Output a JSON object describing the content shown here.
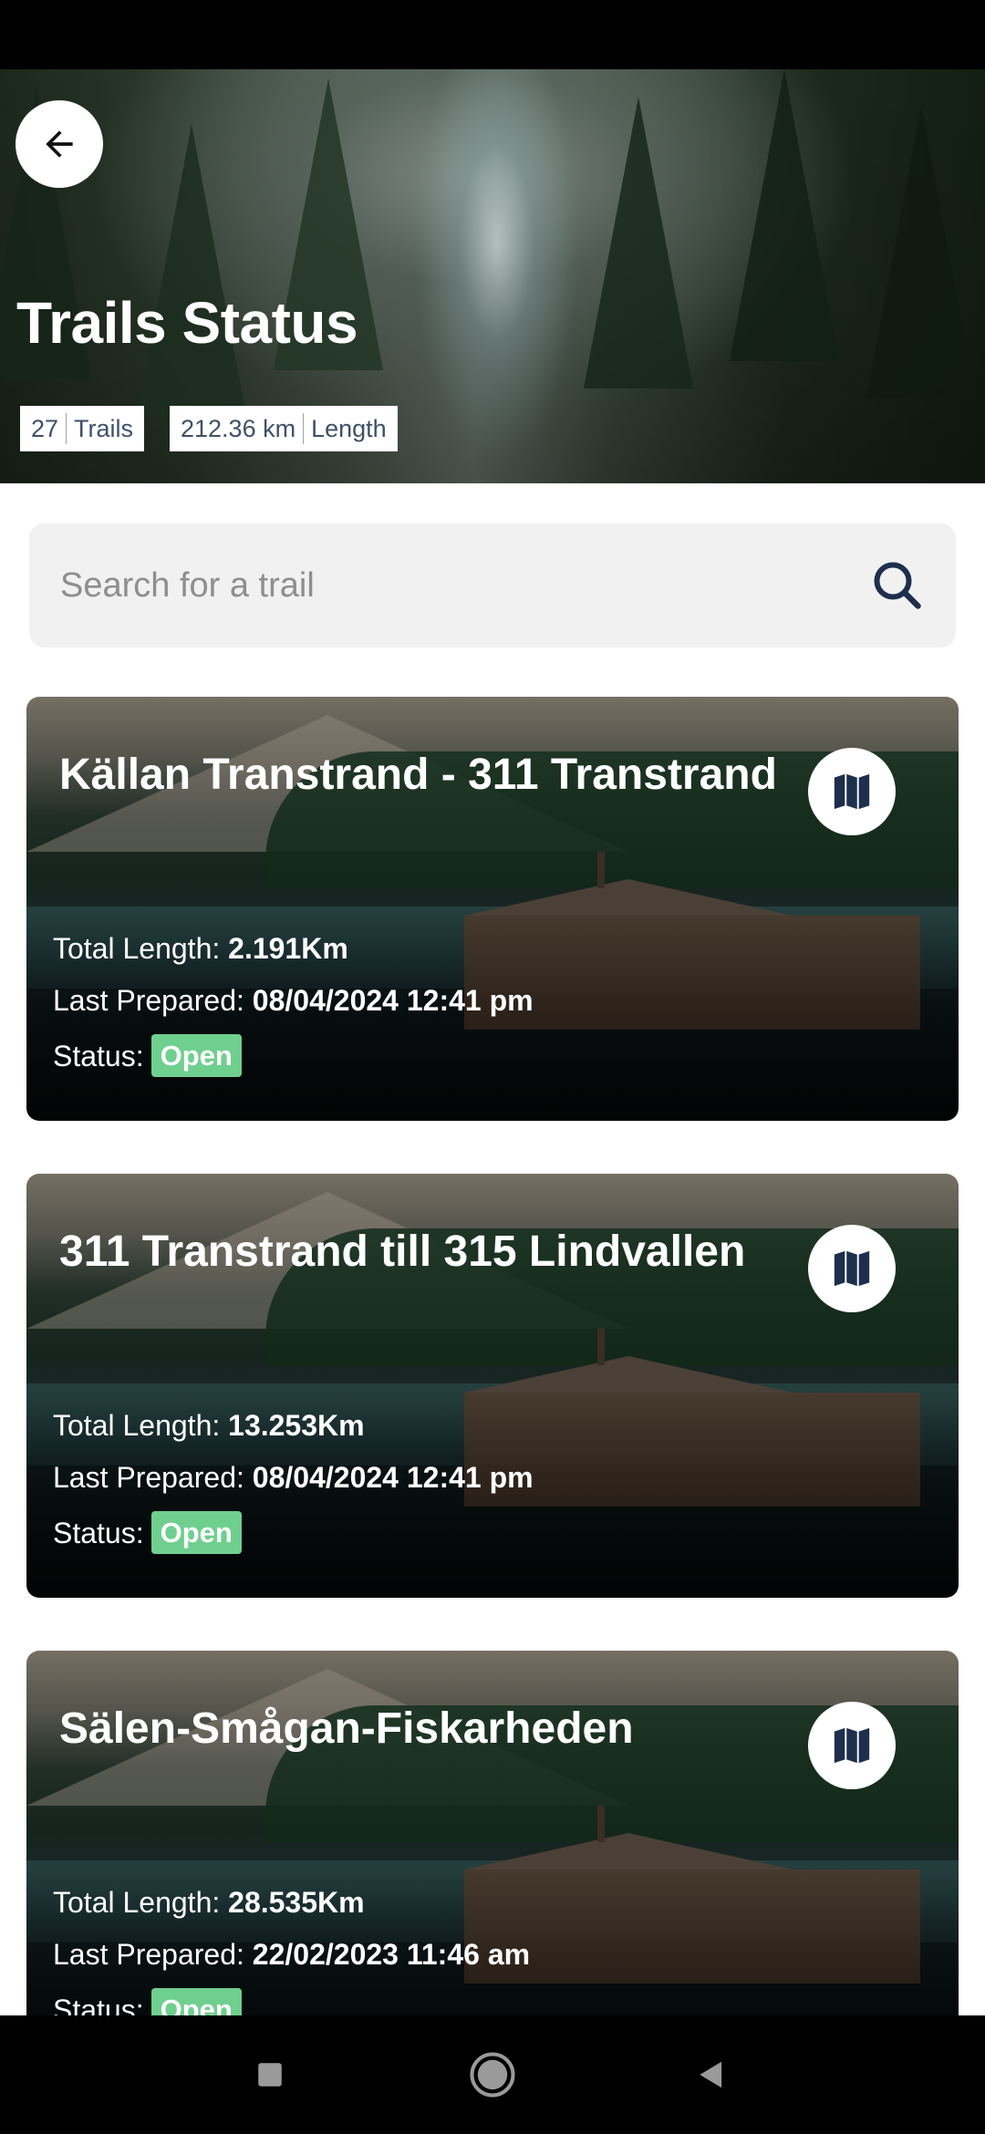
{
  "header": {
    "title": "Trails Status",
    "stats": [
      {
        "value": "27",
        "label": "Trails"
      },
      {
        "value": "212.36 km",
        "label": "Length"
      }
    ]
  },
  "search": {
    "placeholder": "Search for a trail"
  },
  "cards": [
    {
      "title": "Källan Transtrand - 311 Transtrand",
      "length_label": "Total Length:",
      "length": "2.191Km",
      "prepared_label": "Last Prepared:",
      "prepared": "08/04/2024 12:41 pm",
      "status_label": "Status:",
      "status": "Open"
    },
    {
      "title": "311 Transtrand till 315 Lindvallen",
      "length_label": "Total Length:",
      "length": "13.253Km",
      "prepared_label": "Last Prepared:",
      "prepared": "08/04/2024 12:41 pm",
      "status_label": "Status:",
      "status": "Open"
    },
    {
      "title": "Sälen-Smågan-Fiskarheden",
      "length_label": "Total Length:",
      "length": "28.535Km",
      "prepared_label": "Last Prepared:",
      "prepared": "22/02/2023 11:46 am",
      "status_label": "Status:",
      "status": "Open"
    }
  ],
  "colors": {
    "status_open": "#6fcf8f",
    "brand_navy": "#1e2f4e"
  },
  "icons": {
    "back": "arrow-left-icon",
    "search": "search-icon",
    "map": "map-icon",
    "nav_recents": "square-icon",
    "nav_home": "circle-icon",
    "nav_back": "triangle-back-icon"
  }
}
